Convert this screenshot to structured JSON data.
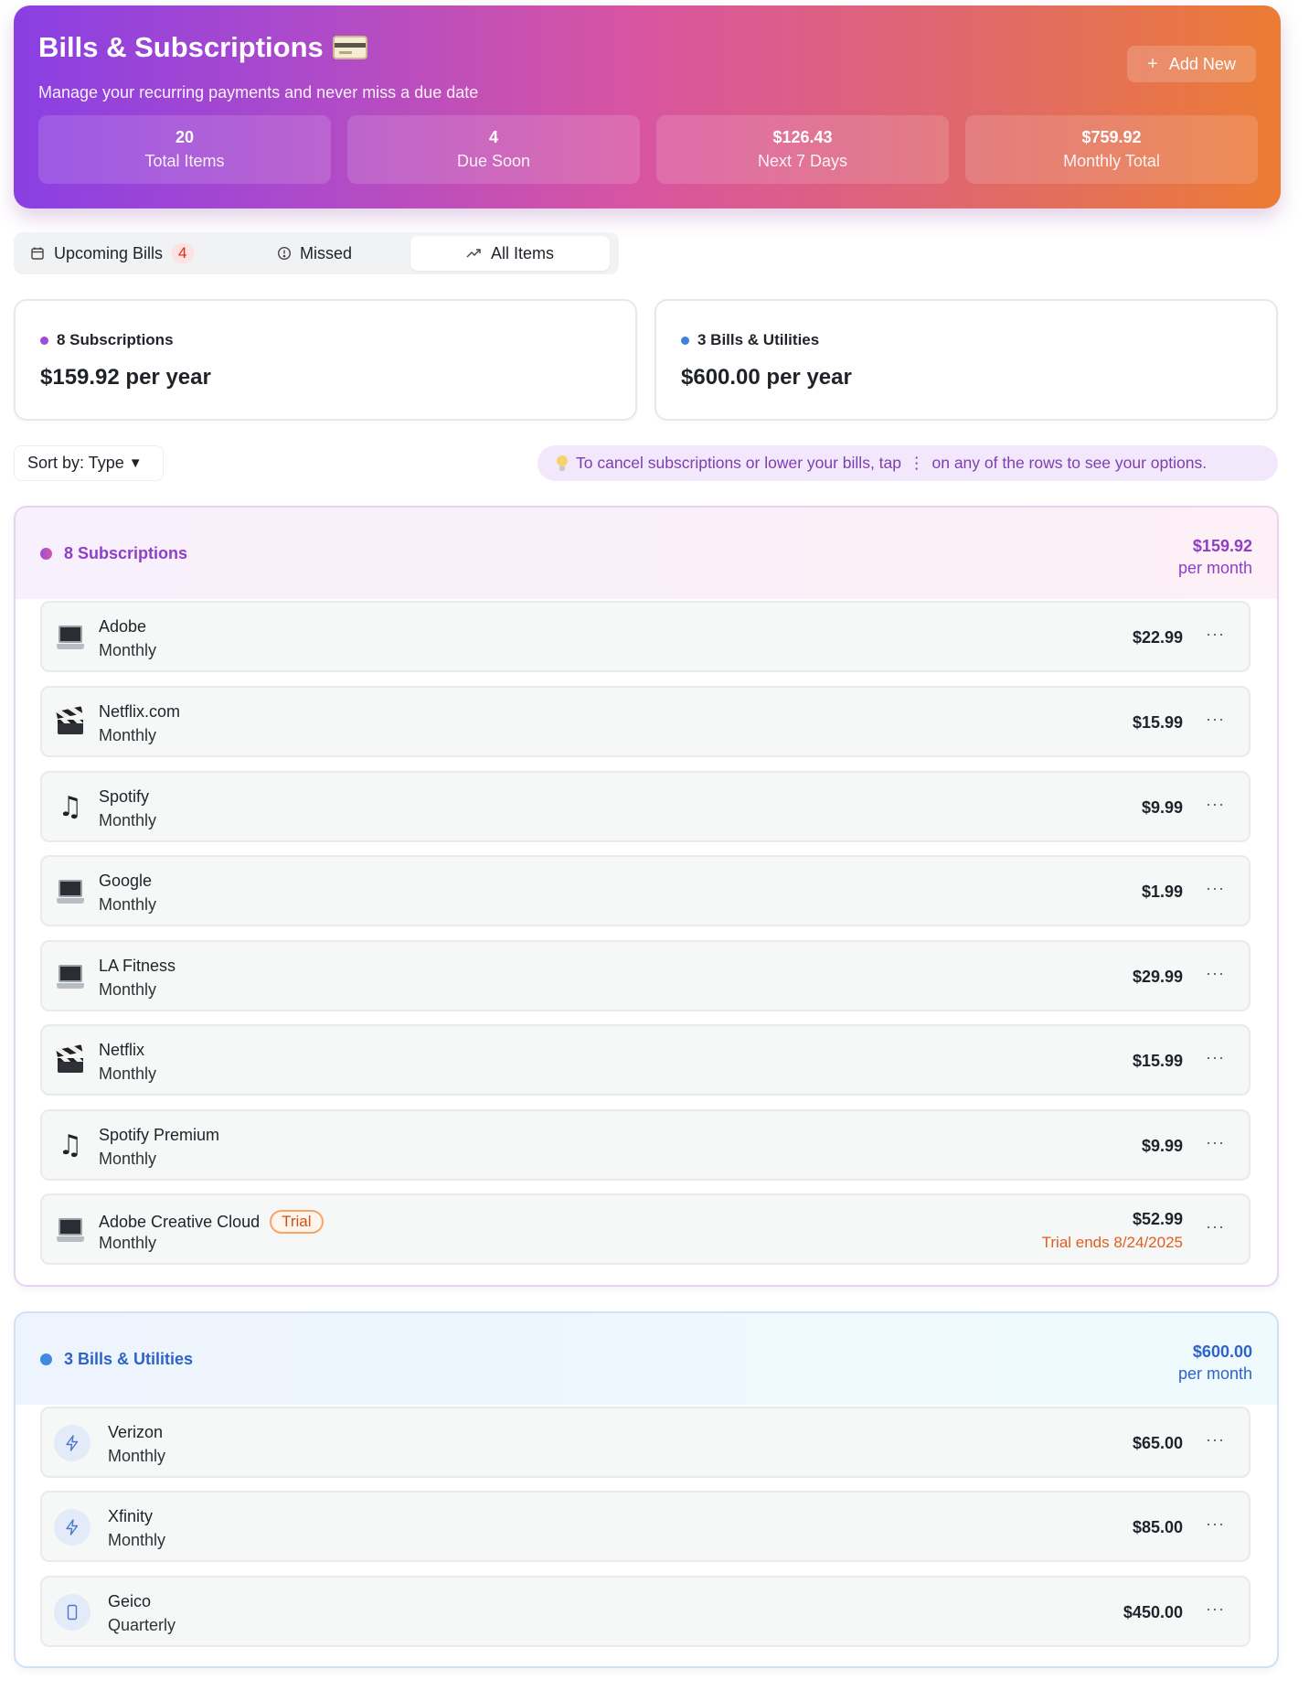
{
  "header": {
    "title": "Bills & Subscriptions",
    "title_icon": "credit-card-icon",
    "subtitle": "Manage your recurring payments and never miss a due date",
    "add_new_label": "Add New",
    "stats": [
      {
        "value": "20",
        "label": "Total Items"
      },
      {
        "value": "4",
        "label": "Due Soon"
      },
      {
        "value": "$126.43",
        "label": "Next 7 Days"
      },
      {
        "value": "$759.92",
        "label": "Monthly Total"
      }
    ]
  },
  "tabs": [
    {
      "label": "Upcoming Bills",
      "badge": "4",
      "icon": "calendar-icon"
    },
    {
      "label": "Missed",
      "icon": "alert-circle-icon"
    },
    {
      "label": "All Items",
      "icon": "trending-up-icon",
      "active": true
    }
  ],
  "summary": [
    {
      "label": "8 Subscriptions",
      "amount": "$159.92 per year",
      "dot_color": "#a04bd6"
    },
    {
      "label": "3 Bills & Utilities",
      "amount": "$600.00 per year",
      "dot_color": "#3f7fe0"
    }
  ],
  "sort_label": "Sort by: Type",
  "tip": {
    "text_before": "To cancel subscriptions or lower your bills, tap",
    "menu_glyph": "⋮",
    "text_after": "on any of the rows to see your options."
  },
  "subscriptions": {
    "title": "8 Subscriptions",
    "total": "$159.92",
    "period": "per month",
    "accent": "#8e3fc7",
    "items": [
      {
        "name": "Adobe",
        "freq": "Monthly",
        "price": "$22.99",
        "icon": "laptop-icon"
      },
      {
        "name": "Netflix.com",
        "freq": "Monthly",
        "price": "$15.99",
        "icon": "clapper-icon"
      },
      {
        "name": "Spotify",
        "freq": "Monthly",
        "price": "$9.99",
        "icon": "music-note-icon"
      },
      {
        "name": "Google",
        "freq": "Monthly",
        "price": "$1.99",
        "icon": "laptop-icon"
      },
      {
        "name": "LA Fitness",
        "freq": "Monthly",
        "price": "$29.99",
        "icon": "laptop-icon"
      },
      {
        "name": "Netflix",
        "freq": "Monthly",
        "price": "$15.99",
        "icon": "clapper-icon"
      },
      {
        "name": "Spotify Premium",
        "freq": "Monthly",
        "price": "$9.99",
        "icon": "music-note-icon"
      },
      {
        "name": "Adobe Creative Cloud",
        "freq": "Monthly",
        "price": "$52.99",
        "icon": "laptop-icon",
        "badge": "Trial",
        "note": "Trial ends 8/24/2025"
      }
    ]
  },
  "bills": {
    "title": "3 Bills & Utilities",
    "total": "$600.00",
    "period": "per month",
    "accent": "#2f63c8",
    "items": [
      {
        "name": "Verizon",
        "freq": "Monthly",
        "price": "$65.00",
        "icon": "lightning-icon"
      },
      {
        "name": "Xfinity",
        "freq": "Monthly",
        "price": "$85.00",
        "icon": "lightning-icon"
      },
      {
        "name": "Geico",
        "freq": "Quarterly",
        "price": "$450.00",
        "icon": "phone-icon"
      }
    ]
  },
  "more_glyph": "···"
}
